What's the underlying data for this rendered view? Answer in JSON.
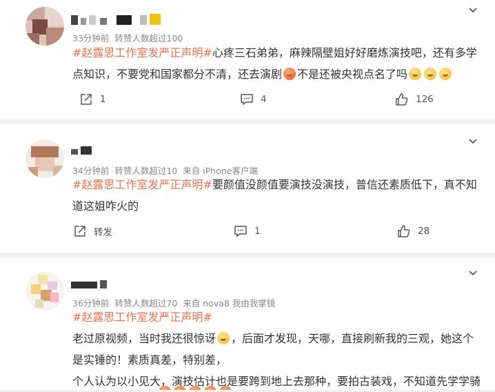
{
  "posts": [
    {
      "time": "33分钟前",
      "likes_note": "转赞人数超过100",
      "device": "",
      "hashtag": "#赵露思工作室发严正声明#",
      "text_a": "心疼三石弟弟，麻辣隔壁姐好好磨炼演技吧，还有多学点知识，不要党和国家都分不清，还去演剧",
      "text_b": "不是还被央视点名了吗",
      "share": "1",
      "comments": "4",
      "likes": "126"
    },
    {
      "time": "34分钟前",
      "likes_note": "转赞人数超过10",
      "device": "来自 iPhone客户端",
      "hashtag": "#赵露思工作室发严正声明#",
      "text_a": "要颜值没颜值要演技没演技，普信还素质低下，真不知道这姐咋火的",
      "share": "转发",
      "comments": "1",
      "likes": "28"
    },
    {
      "time": "36分钟前",
      "likes_note": "转赞人数超过70",
      "device": "来自 nova8 我由我掌镜",
      "hashtag": "#赵露思工作室发严正声明#",
      "line1": "老过原视频，当时我还很惊讶",
      "line1b": "，后面才发现，天哪，直接刷新我的三观，她这个是实锤的！素质真差，特别差，",
      "line2": "个人认为以小见大，演技估计也是要跨到地上去那种，要拍古装戏，不知道先学学骑"
    }
  ],
  "icons": {
    "chevron": "chevron-down-icon",
    "share": "share-icon",
    "comment": "comment-icon",
    "like": "thumbs-up-icon"
  }
}
